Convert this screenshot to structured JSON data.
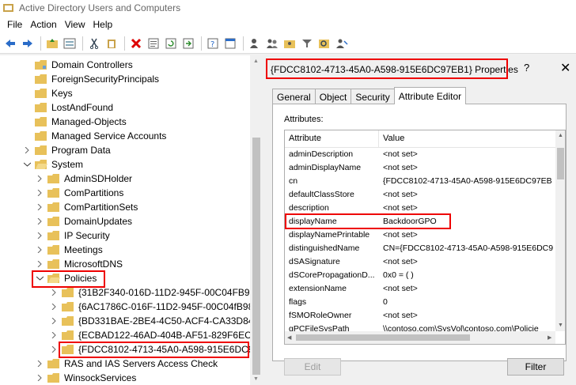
{
  "window": {
    "title": "Active Directory Users and Computers"
  },
  "menu": [
    "File",
    "Action",
    "View",
    "Help"
  ],
  "toolbar": {
    "icons": [
      "back-arrow-icon",
      "forward-arrow-icon",
      "folder-up-icon",
      "details-view-icon",
      "cut-icon",
      "paste-icon",
      "delete-icon",
      "properties-icon",
      "refresh-icon",
      "export-icon",
      "help-icon",
      "console-icon",
      "add-user-icon",
      "add-group-icon",
      "add-ou-icon",
      "filter-icon",
      "find-icon",
      "delegate-icon"
    ]
  },
  "tree": {
    "items": [
      {
        "label": "Domain Controllers",
        "expanded": false
      },
      {
        "label": "ForeignSecurityPrincipals",
        "expanded": false
      },
      {
        "label": "Keys",
        "expanded": false
      },
      {
        "label": "LostAndFound",
        "expanded": false
      },
      {
        "label": "Managed-Objects",
        "expanded": false
      },
      {
        "label": "Managed Service Accounts",
        "expanded": false
      },
      {
        "label": "Program Data",
        "expanded": false
      },
      {
        "label": "System",
        "expanded": true
      },
      {
        "label": "AdminSDHolder",
        "expanded": false
      },
      {
        "label": "ComPartitions",
        "expanded": false
      },
      {
        "label": "ComPartitionSets",
        "expanded": false
      },
      {
        "label": "DomainUpdates",
        "expanded": false
      },
      {
        "label": "IP Security",
        "expanded": false
      },
      {
        "label": "Meetings",
        "expanded": false
      },
      {
        "label": "MicrosoftDNS",
        "expanded": false
      },
      {
        "label": "Policies",
        "expanded": true
      },
      {
        "label": "{31B2F340-016D-11D2-945F-00C04FB984",
        "expanded": false
      },
      {
        "label": "{6AC1786C-016F-11D2-945F-00C04fB984",
        "expanded": false
      },
      {
        "label": "{BD331BAE-2BE4-4C50-ACF4-CA33D84F",
        "expanded": false
      },
      {
        "label": "{ECBAD122-46AD-404B-AF51-829F6ECD7",
        "expanded": false
      },
      {
        "label": "{FDCC8102-4713-45A0-A598-915E6DC97",
        "expanded": false
      },
      {
        "label": "RAS and IAS Servers Access Check",
        "expanded": false
      },
      {
        "label": "WinsockServices",
        "expanded": false
      }
    ]
  },
  "dialog": {
    "title": "{FDCC8102-4713-45A0-A598-915E6DC97EB1} Properties",
    "help": "?",
    "close": "✕",
    "tabs": [
      "General",
      "Object",
      "Security",
      "Attribute Editor"
    ],
    "active_tab": "Attribute Editor",
    "attributes_caption": "Attributes:",
    "columns": [
      "Attribute",
      "Value"
    ],
    "rows": [
      {
        "attribute": "adminDescription",
        "value": "<not set>"
      },
      {
        "attribute": "adminDisplayName",
        "value": "<not set>"
      },
      {
        "attribute": "cn",
        "value": "{FDCC8102-4713-45A0-A598-915E6DC97EB"
      },
      {
        "attribute": "defaultClassStore",
        "value": "<not set>"
      },
      {
        "attribute": "description",
        "value": "<not set>"
      },
      {
        "attribute": "displayName",
        "value": "BackdoorGPO"
      },
      {
        "attribute": "displayNamePrintable",
        "value": "<not set>"
      },
      {
        "attribute": "distinguishedName",
        "value": "CN={FDCC8102-4713-45A0-A598-915E6DC9"
      },
      {
        "attribute": "dSASignature",
        "value": "<not set>"
      },
      {
        "attribute": "dSCorePropagationD...",
        "value": "0x0 = ( )"
      },
      {
        "attribute": "extensionName",
        "value": "<not set>"
      },
      {
        "attribute": "flags",
        "value": "0"
      },
      {
        "attribute": "fSMORoleOwner",
        "value": "<not set>"
      },
      {
        "attribute": "gPCFileSysPath",
        "value": "\\\\contoso.com\\SysVol\\contoso.com\\Policie"
      }
    ],
    "edit_label": "Edit",
    "filter_label": "Filter"
  },
  "colors": {
    "highlight": "#e00000",
    "folder": "#e8c15a"
  }
}
